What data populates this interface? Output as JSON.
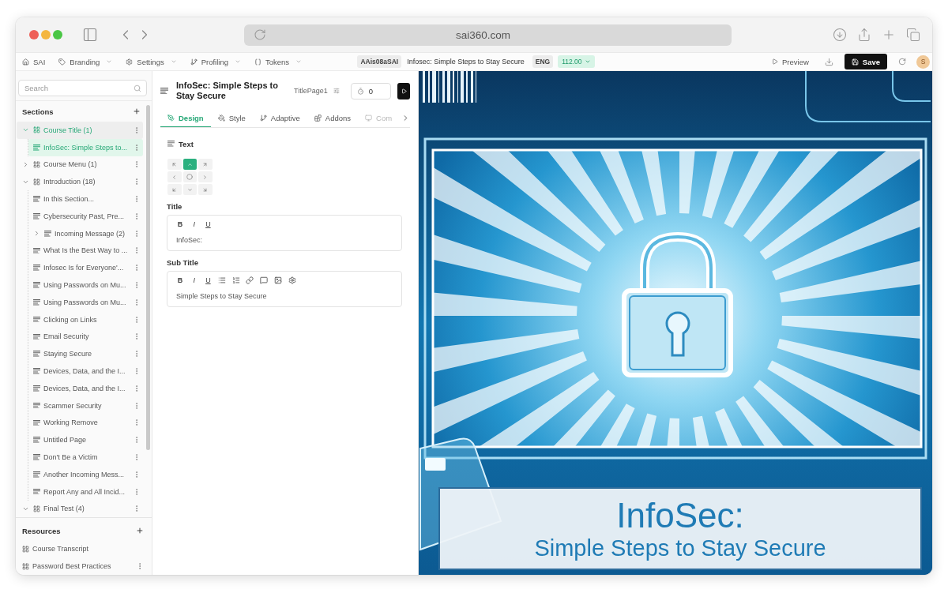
{
  "browser": {
    "url": "sai360.com"
  },
  "toolbar": {
    "menus": [
      {
        "label": "SAI",
        "dropdown": false
      },
      {
        "label": "Branding",
        "dropdown": true
      },
      {
        "label": "Settings",
        "dropdown": true
      },
      {
        "label": "Profiling",
        "dropdown": true
      },
      {
        "label": "Tokens",
        "dropdown": true
      }
    ],
    "course_code": "AAis08aSAI",
    "course_title": "Infosec: Simple Steps to Stay Secure",
    "language": "ENG",
    "version": "112.00",
    "preview": "Preview",
    "save": "Save",
    "avatar": "S"
  },
  "sidebar": {
    "search": {
      "placeholder": "Search"
    },
    "sections_title": "Sections",
    "tree": [
      {
        "kind": "section",
        "label": "Course Title (1)",
        "expanded": true,
        "active": true,
        "selected": false,
        "children": [
          {
            "kind": "page",
            "label": "InfoSec: Simple Steps to...",
            "active": false,
            "selected": true
          }
        ]
      },
      {
        "kind": "section",
        "label": "Course Menu (1)",
        "expanded": false,
        "active": false,
        "selected": false
      },
      {
        "kind": "section",
        "label": "Introduction (18)",
        "expanded": true,
        "active": false,
        "selected": false,
        "children": [
          {
            "kind": "page",
            "label": "In this Section...",
            "active": false,
            "selected": false
          },
          {
            "kind": "page",
            "label": "Cybersecurity Past, Pre...",
            "active": false,
            "selected": false
          },
          {
            "kind": "page",
            "label": "Incoming Message (2)",
            "expanded": false,
            "active": false,
            "selected": false
          },
          {
            "kind": "page",
            "label": "What Is the Best Way to ...",
            "active": false,
            "selected": false
          },
          {
            "kind": "page",
            "label": "Infosec Is for Everyone'...",
            "active": false,
            "selected": false
          },
          {
            "kind": "page",
            "label": "Using Passwords on Mu...",
            "active": false,
            "selected": false
          },
          {
            "kind": "page",
            "label": "Using Passwords on Mu...",
            "active": false,
            "selected": false
          },
          {
            "kind": "page",
            "label": "Clicking on Links",
            "active": false,
            "selected": false
          },
          {
            "kind": "page",
            "label": "Email Security",
            "active": false,
            "selected": false
          },
          {
            "kind": "page",
            "label": "Staying Secure",
            "active": false,
            "selected": false
          },
          {
            "kind": "page",
            "label": "Devices, Data, and the I...",
            "active": false,
            "selected": false
          },
          {
            "kind": "page",
            "label": "Devices, Data, and the I...",
            "active": false,
            "selected": false
          },
          {
            "kind": "page",
            "label": "Scammer Security",
            "active": false,
            "selected": false
          },
          {
            "kind": "page",
            "label": "Working Remove",
            "active": false,
            "selected": false
          },
          {
            "kind": "page",
            "label": "Untitled Page",
            "active": false,
            "selected": false
          },
          {
            "kind": "page",
            "label": "Don't Be a Victim",
            "active": false,
            "selected": false
          },
          {
            "kind": "page",
            "label": "Another Incoming Mess...",
            "active": false,
            "selected": false
          },
          {
            "kind": "page",
            "label": "Report Any and All Incid...",
            "active": false,
            "selected": false
          }
        ]
      },
      {
        "kind": "section",
        "label": "Final Test (4)",
        "expanded": true,
        "active": false,
        "selected": false
      }
    ],
    "resources_title": "Resources",
    "resources": [
      {
        "label": "Course Transcript",
        "has_menu": false
      },
      {
        "label": "Password Best Practices",
        "has_menu": true
      }
    ]
  },
  "editor": {
    "title": "InfoSec: Simple Steps to Stay Secure",
    "page_id": "TitlePage1",
    "timer": "0",
    "tabs": [
      {
        "label": "Design",
        "selected": true
      },
      {
        "label": "Style",
        "selected": false
      },
      {
        "label": "Adaptive",
        "selected": false
      },
      {
        "label": "Addons",
        "selected": false
      },
      {
        "label": "Com",
        "selected": false
      }
    ],
    "section_title": "Text",
    "alignment": [
      {
        "selected": false
      },
      {
        "selected": true
      },
      {
        "selected": false
      },
      {
        "selected": false
      },
      {
        "selected": false
      },
      {
        "selected": false
      },
      {
        "selected": false
      },
      {
        "selected": false
      },
      {
        "selected": false
      }
    ],
    "fields": [
      {
        "label": "Title",
        "tools": [
          {
            "kind": "bold",
            "label": "B"
          },
          {
            "kind": "italic",
            "label": "I"
          },
          {
            "kind": "underline",
            "label": "U"
          }
        ],
        "value": "InfoSec:"
      },
      {
        "label": "Sub Title",
        "tools": [
          {
            "kind": "bold",
            "label": "B"
          },
          {
            "kind": "italic",
            "label": "I"
          },
          {
            "kind": "underline",
            "label": "U"
          },
          {
            "kind": "bullet-list"
          },
          {
            "kind": "numbered-list"
          },
          {
            "kind": "link"
          },
          {
            "kind": "comment"
          },
          {
            "kind": "image"
          },
          {
            "kind": "settings"
          }
        ],
        "value": "Simple Steps to Stay Secure"
      }
    ]
  },
  "slide": {
    "title": "InfoSec:",
    "subtitle": "Simple Steps to Stay Secure"
  }
}
